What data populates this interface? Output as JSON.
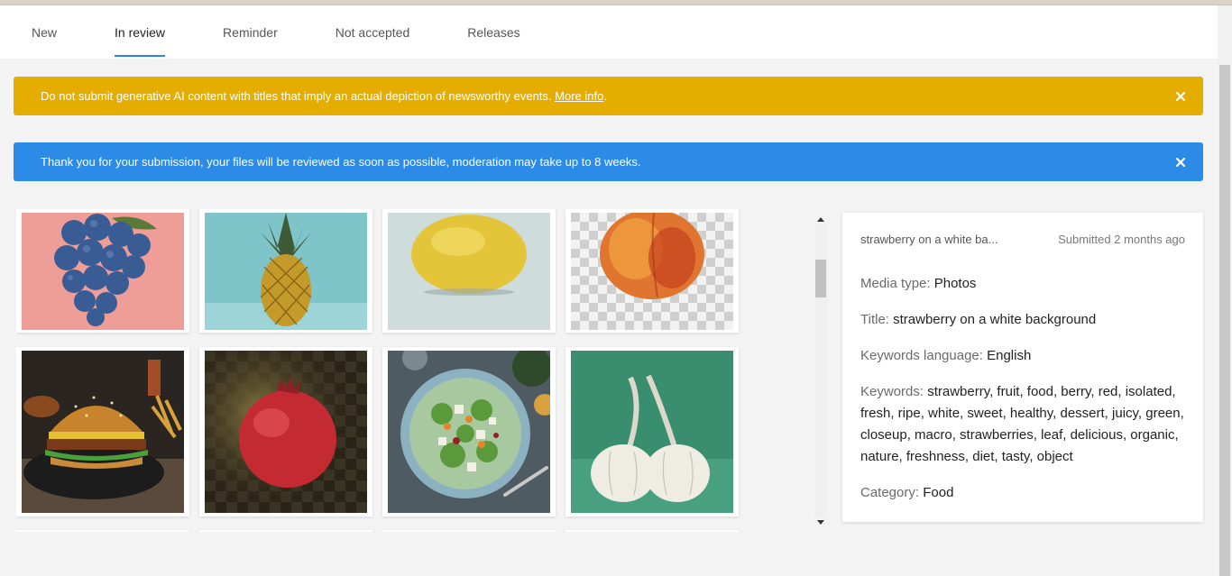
{
  "tabs": [
    {
      "label": "New"
    },
    {
      "label": "In review",
      "active": true
    },
    {
      "label": "Reminder"
    },
    {
      "label": "Not accepted"
    },
    {
      "label": "Releases"
    }
  ],
  "banners": {
    "warning": {
      "text": "Do not submit generative AI content with titles that imply an actual depiction of newsworthy events. ",
      "link": "More info",
      "suffix": ".",
      "color": "#e5ad00"
    },
    "info": {
      "text": "Thank you for your submission, your files will be reviewed as soon as possible, moderation may take up to 8 weeks.",
      "color": "#2d8be8"
    }
  },
  "thumbnails": [
    {
      "subject": "blueberry-cluster",
      "bg": "#ee9e96"
    },
    {
      "subject": "pineapple",
      "bg": "#7ec4c9"
    },
    {
      "subject": "lemon",
      "bg": "#cfdcdc"
    },
    {
      "subject": "peach",
      "bg": "checker"
    },
    {
      "subject": "burger",
      "bg": "#2a2520"
    },
    {
      "subject": "pomegranate",
      "bg": "#3b3220"
    },
    {
      "subject": "salad",
      "bg": "#4f5b63"
    },
    {
      "subject": "garlic",
      "bg": "#3a8e70"
    }
  ],
  "detail": {
    "name": "strawberry on a white ba...",
    "submitted": "Submitted 2 months ago",
    "media_type_label": "Media type:",
    "media_type": "Photos",
    "title_label": "Title:",
    "title": "strawberry on a white background",
    "keywords_language_label": "Keywords language:",
    "keywords_language": "English",
    "keywords_label": "Keywords:",
    "keywords": "strawberry, fruit, food, berry, red, isolated, fresh, ripe, white, sweet, healthy, dessert, juicy, green, closeup, macro, strawberries, leaf, delicious, organic, nature, freshness, diet, tasty, object",
    "category_label": "Category:",
    "category": "Food"
  },
  "colors": {
    "accent": "#2d83e8"
  }
}
